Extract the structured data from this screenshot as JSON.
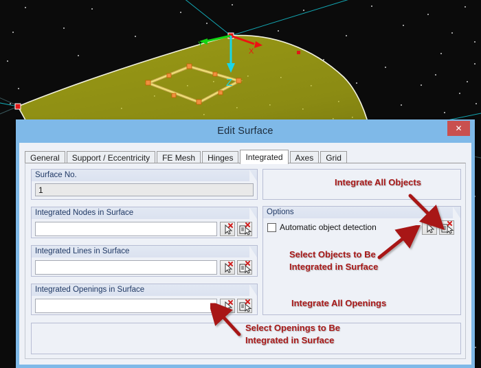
{
  "viewport": {
    "name": "3d-model-viewport",
    "background_color": "#0b0b0b",
    "surface_color": "#8a8a12",
    "axis_labels": {
      "x": "X",
      "y": "Y",
      "z": "Z"
    },
    "axis_colors": {
      "x": "#ee1111",
      "y": "#13d413",
      "z": "#19d6e8"
    },
    "grid_line_color": "#12a8b4",
    "node_color": "#e01818",
    "opening_color": "#f4b45a"
  },
  "dialog": {
    "title": "Edit Surface",
    "close_label": "✕",
    "tabs": [
      {
        "label": "General",
        "selected": false
      },
      {
        "label": "Support / Eccentricity",
        "selected": false
      },
      {
        "label": "FE Mesh",
        "selected": false
      },
      {
        "label": "Hinges",
        "selected": false
      },
      {
        "label": "Integrated",
        "selected": true
      },
      {
        "label": "Axes",
        "selected": false
      },
      {
        "label": "Grid",
        "selected": false
      }
    ],
    "left_panel": {
      "surface_no": {
        "caption": "Surface No.",
        "value": "1",
        "readonly": true
      },
      "integrated_nodes": {
        "caption": "Integrated Nodes in Surface",
        "value": ""
      },
      "integrated_lines": {
        "caption": "Integrated Lines in Surface",
        "value": ""
      },
      "integrated_openings": {
        "caption": "Integrated Openings in Surface",
        "value": ""
      },
      "select_button_icon": "select-objects-cursor-icon",
      "all_button_icon": "select-all-list-cursor-icon"
    },
    "right_panel": {
      "top_group": {
        "caption": ""
      },
      "options_group": {
        "caption": "Options",
        "checkbox": {
          "label": "Automatic object detection",
          "checked": false
        }
      },
      "select_button_icon": "select-objects-cursor-icon",
      "all_button_icon": "select-all-list-cursor-icon"
    }
  },
  "annotations": [
    {
      "id": "integrate-all-objects",
      "text": "Integrate All Objects"
    },
    {
      "id": "select-objects-line1",
      "text": "Select Objects to Be"
    },
    {
      "id": "select-objects-line2",
      "text": "Integrated in Surface"
    },
    {
      "id": "integrate-all-openings",
      "text": "Integrate All Openings"
    },
    {
      "id": "select-openings-line1",
      "text": "Select Openings to Be"
    },
    {
      "id": "select-openings-line2",
      "text": "Integrated in Surface"
    }
  ],
  "annotation_color": "#a81919"
}
